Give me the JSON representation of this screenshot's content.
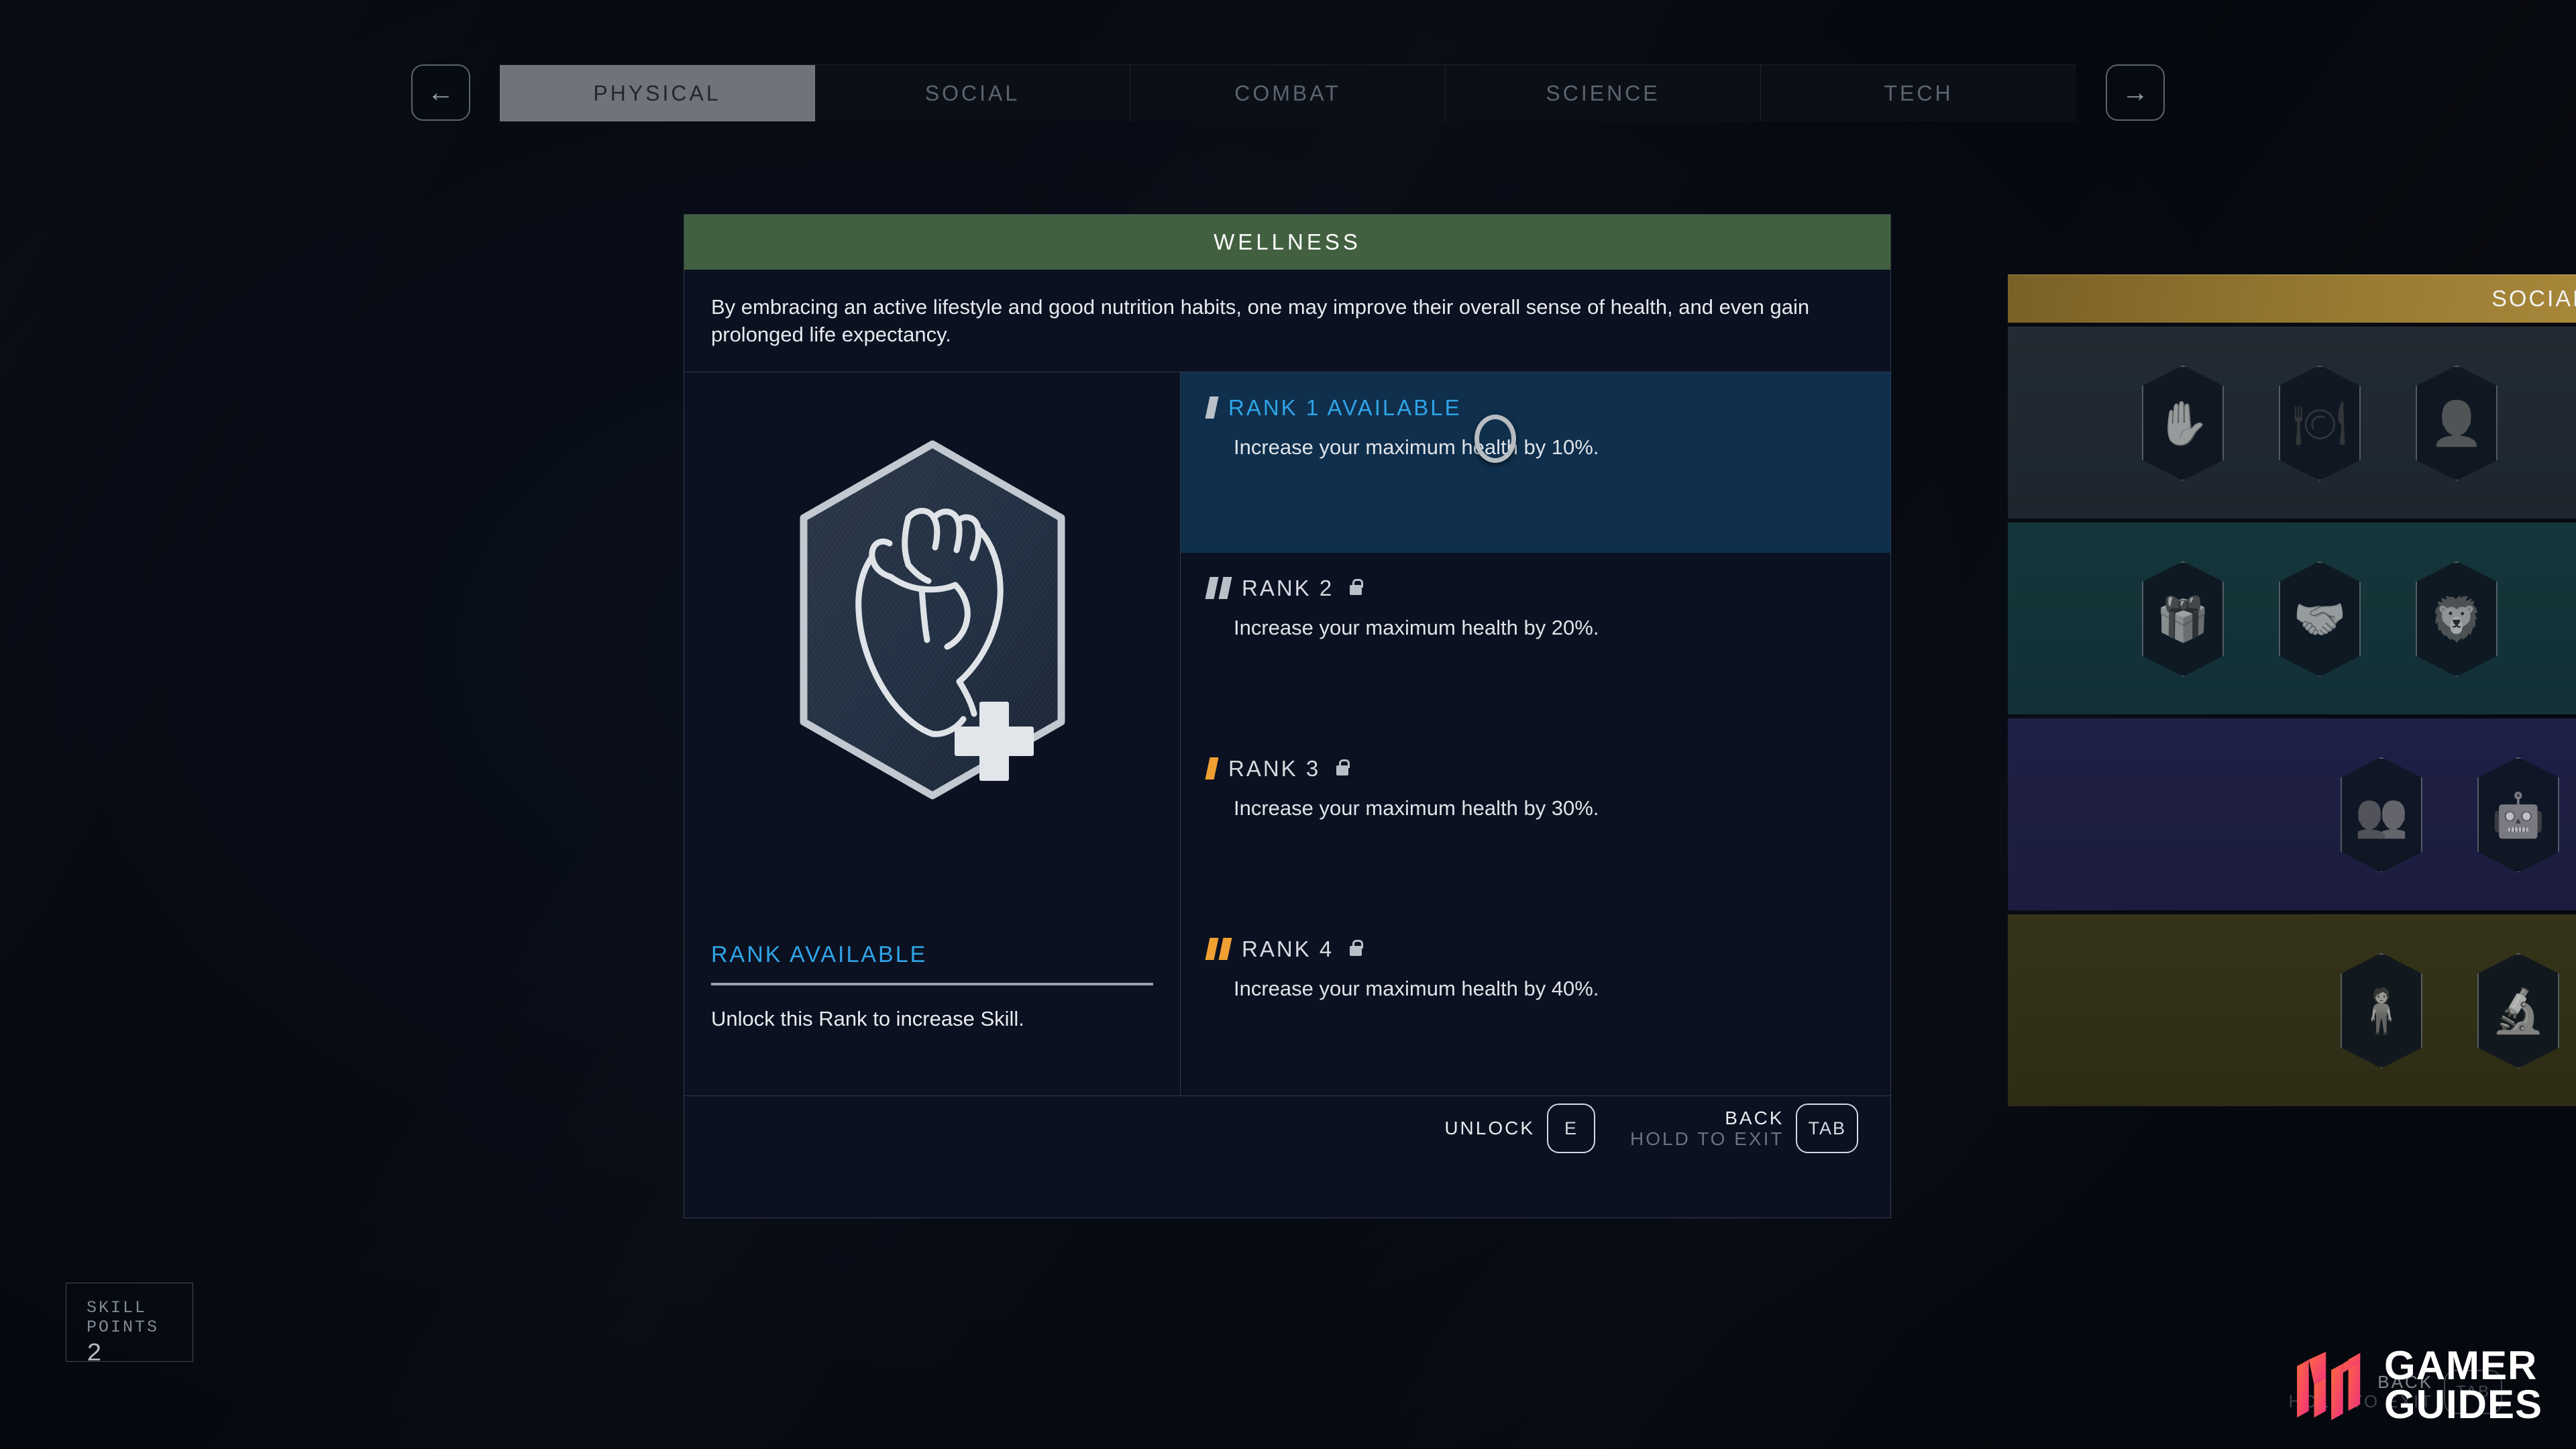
{
  "nav": {
    "prev_icon": "arrow-left-icon",
    "next_icon": "arrow-right-icon",
    "prev_label": "←",
    "next_label": "→"
  },
  "tabs": [
    {
      "label": "PHYSICAL",
      "active": true
    },
    {
      "label": "SOCIAL",
      "active": false
    },
    {
      "label": "COMBAT",
      "active": false
    },
    {
      "label": "SCIENCE",
      "active": false
    },
    {
      "label": "TECH",
      "active": false
    }
  ],
  "skill": {
    "name": "WELLNESS",
    "header_color": "#426040",
    "description": "By embracing an active lifestyle and good nutrition habits, one may improve their overall sense of health, and even gain prolonged life expectancy.",
    "badge_icon": "anatomical-heart-medical-cross-patch-icon",
    "status_title": "RANK AVAILABLE",
    "status_color": "#2fa4e7",
    "status_subtitle": "Unlock this Rank to increase Skill.",
    "ranks": [
      {
        "label": "RANK 1 AVAILABLE",
        "description": "Increase your maximum health by 10%.",
        "bars": 1,
        "bar_color": "#b9c0c8",
        "locked": false,
        "selected": true
      },
      {
        "label": "RANK 2",
        "description": "Increase your maximum health by 20%.",
        "bars": 2,
        "bar_color": "#b9c0c8",
        "locked": true,
        "selected": false
      },
      {
        "label": "RANK 3",
        "description": "Increase your maximum health by 30%.",
        "bars": 1,
        "bar_color": "#f0a032",
        "locked": true,
        "selected": false
      },
      {
        "label": "RANK 4",
        "description": "Increase your maximum health by 40%.",
        "bars": 2,
        "bar_color": "#f0a032",
        "locked": true,
        "selected": false
      }
    ]
  },
  "footer": {
    "unlock_label": "UNLOCK",
    "unlock_key": "E",
    "back_label": "BACK",
    "back_hold_label": "HOLD TO EXIT",
    "back_key": "TAB"
  },
  "skill_points": {
    "label": "SKILL POINTS",
    "value": "2"
  },
  "hud_bottom": {
    "back_label": "BACK",
    "back_hold_label": "HOLD TO EXIT",
    "back_key": "TAB"
  },
  "background_grid": {
    "category_label": "SOCIAL",
    "category_color": "#9a7c32",
    "rows": [
      {
        "tint": "#222b33",
        "icons": [
          "coin-flip-hand-icon",
          "food-plate-hand-icon",
          "face-persuasion-icon"
        ]
      },
      {
        "tint": "#15363a",
        "icons": [
          "money-gift-exchange-icon",
          "handshake-space-icon",
          "beast-roar-icon"
        ]
      },
      {
        "tint": "#1f2046",
        "icons": [
          "crowd-leader-icon",
          "robot-squad-icon"
        ]
      },
      {
        "tint": "#353318",
        "icons": [
          "puppet-marionette-icon",
          "microscope-icon"
        ]
      }
    ]
  },
  "watermark": {
    "line1": "GAMER",
    "line2": "GUIDES",
    "logo_color_start": "#ff6a3d",
    "logo_color_end": "#f0317e"
  }
}
